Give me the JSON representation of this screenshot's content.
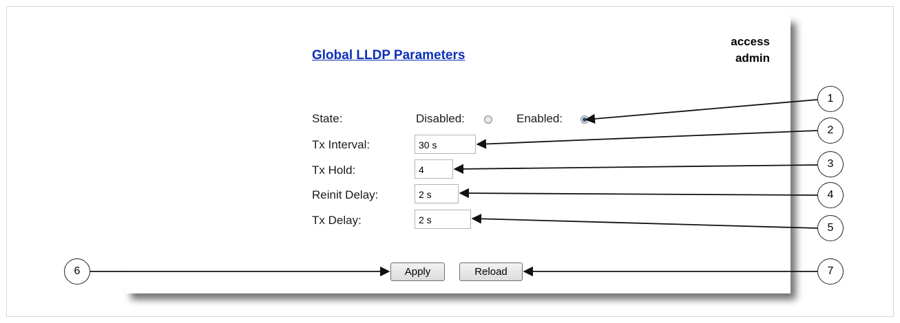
{
  "page": {
    "title": "Global LLDP Parameters",
    "user": {
      "line1": "access",
      "line2": "admin"
    }
  },
  "form": {
    "state_label": "State:",
    "disabled_label": "Disabled:",
    "enabled_label": "Enabled:",
    "state_selected": "Enabled",
    "tx_interval_label": "Tx Interval:",
    "tx_interval_value": "30 s",
    "tx_hold_label": "Tx Hold:",
    "tx_hold_value": "4",
    "reinit_delay_label": "Reinit Delay:",
    "reinit_delay_value": "2 s",
    "tx_delay_label": "Tx Delay:",
    "tx_delay_value": "2 s"
  },
  "buttons": {
    "apply": "Apply",
    "reload": "Reload"
  },
  "callouts": [
    "1",
    "2",
    "3",
    "4",
    "5",
    "6",
    "7"
  ]
}
